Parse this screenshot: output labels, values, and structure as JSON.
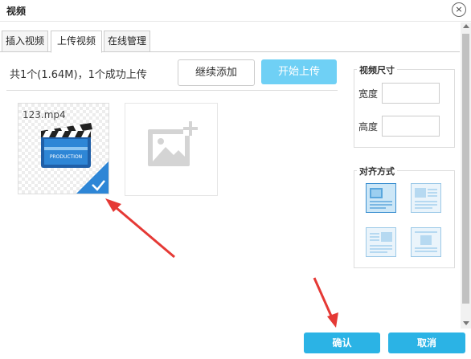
{
  "dialog": {
    "title": "视频",
    "close_glyph": "×"
  },
  "tabs": [
    {
      "label": "插入视频",
      "active": false
    },
    {
      "label": "上传视频",
      "active": true
    },
    {
      "label": "在线管理",
      "active": false
    }
  ],
  "upload": {
    "status": "共1个(1.64M)，1个成功上传",
    "add_label": "继续添加",
    "start_label": "开始上传"
  },
  "files": [
    {
      "name": "123.mp4",
      "icon": "clapperboard-icon",
      "uploaded": true,
      "thumb_text": "PRODUCTION"
    }
  ],
  "add_placeholder_icon": "add-image-icon",
  "video_size": {
    "legend": "视频尺寸",
    "width_label": "宽度",
    "width_value": "",
    "height_label": "高度",
    "height_value": ""
  },
  "alignment": {
    "legend": "对齐方式",
    "options": [
      "none",
      "left",
      "right",
      "center"
    ],
    "selected": "none"
  },
  "footer": {
    "ok_label": "确认",
    "cancel_label": "取消"
  },
  "colors": {
    "accent": "#2bb3e5",
    "start_button": "#6fd0f5",
    "annotation": "#e53935"
  }
}
